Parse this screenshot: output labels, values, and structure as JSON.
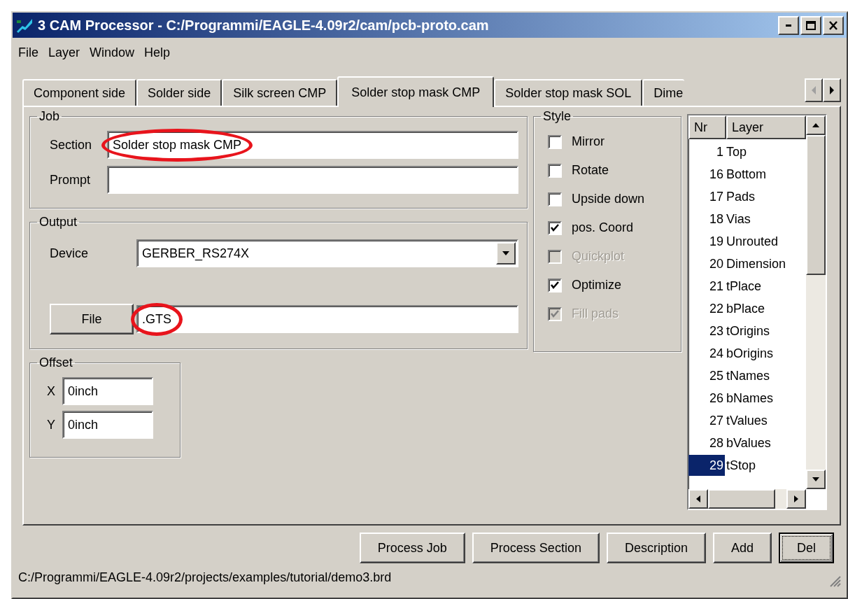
{
  "window": {
    "title": "3 CAM Processor - C:/Programmi/EAGLE-4.09r2/cam/pcb-proto.cam"
  },
  "menu": [
    "File",
    "Layer",
    "Window",
    "Help"
  ],
  "tabs": [
    {
      "label": "Component side",
      "selected": false
    },
    {
      "label": "Solder side",
      "selected": false
    },
    {
      "label": "Silk screen CMP",
      "selected": false
    },
    {
      "label": "Solder stop mask CMP",
      "selected": true
    },
    {
      "label": "Solder stop mask SOL",
      "selected": false
    },
    {
      "label": "Dime",
      "selected": false
    }
  ],
  "job": {
    "title": "Job",
    "section": {
      "label": "Section",
      "value": "Solder stop mask CMP",
      "circled": true
    },
    "prompt": {
      "label": "Prompt"
    }
  },
  "output": {
    "title": "Output",
    "device": {
      "label": "Device",
      "value": "GERBER_RS274X"
    },
    "file": {
      "button": "File",
      "value": ".GTS",
      "circled": true
    }
  },
  "offset": {
    "title": "Offset",
    "fields": [
      {
        "label": "X",
        "value": "0inch"
      },
      {
        "label": "Y",
        "value": "0inch"
      }
    ]
  },
  "style": {
    "title": "Style",
    "options": [
      {
        "label": "Mirror",
        "checked": false,
        "disabled": false
      },
      {
        "label": "Rotate",
        "checked": false,
        "disabled": false
      },
      {
        "label": "Upside down",
        "checked": false,
        "disabled": false
      },
      {
        "label": "pos. Coord",
        "checked": true,
        "disabled": false
      },
      {
        "label": "Quickplot",
        "checked": false,
        "disabled": true
      },
      {
        "label": "Optimize",
        "checked": true,
        "disabled": false
      },
      {
        "label": "Fill pads",
        "checked": true,
        "disabled": true
      }
    ]
  },
  "layers": {
    "columns": [
      "Nr",
      "Layer"
    ],
    "rows": [
      {
        "nr": "1",
        "name": "Top",
        "selected": false
      },
      {
        "nr": "16",
        "name": "Bottom",
        "selected": false
      },
      {
        "nr": "17",
        "name": "Pads",
        "selected": false
      },
      {
        "nr": "18",
        "name": "Vias",
        "selected": false
      },
      {
        "nr": "19",
        "name": "Unrouted",
        "selected": false
      },
      {
        "nr": "20",
        "name": "Dimension",
        "selected": false
      },
      {
        "nr": "21",
        "name": "tPlace",
        "selected": false
      },
      {
        "nr": "22",
        "name": "bPlace",
        "selected": false
      },
      {
        "nr": "23",
        "name": "tOrigins",
        "selected": false
      },
      {
        "nr": "24",
        "name": "bOrigins",
        "selected": false
      },
      {
        "nr": "25",
        "name": "tNames",
        "selected": false
      },
      {
        "nr": "26",
        "name": "bNames",
        "selected": false
      },
      {
        "nr": "27",
        "name": "tValues",
        "selected": false
      },
      {
        "nr": "28",
        "name": "bValues",
        "selected": false
      },
      {
        "nr": "29",
        "name": "tStop",
        "selected": true
      }
    ]
  },
  "buttons": [
    {
      "label": "Process Job",
      "focused": false
    },
    {
      "label": "Process Section",
      "focused": false
    },
    {
      "label": "Description",
      "focused": false
    },
    {
      "label": "Add",
      "focused": false
    },
    {
      "label": "Del",
      "focused": true
    }
  ],
  "status_bar": "C:/Programmi/EAGLE-4.09r2/projects/examples/tutorial/demo3.brd"
}
